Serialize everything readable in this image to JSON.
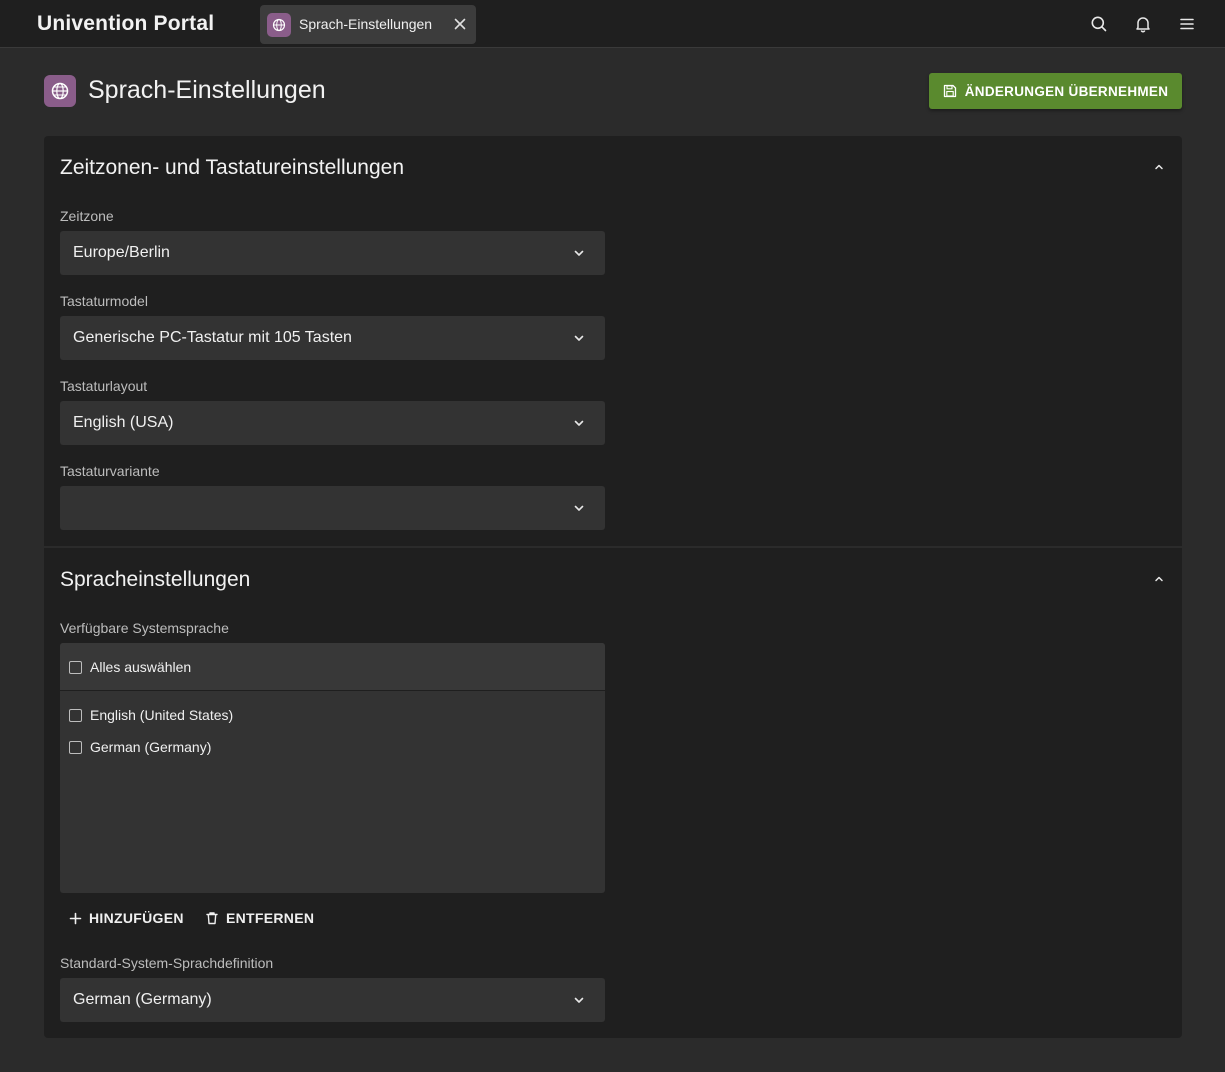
{
  "header": {
    "portal_title": "Univention Portal",
    "tab_label": "Sprach-Einstellungen"
  },
  "page": {
    "title": "Sprach-Einstellungen",
    "save_label": "ÄNDERUNGEN ÜBERNEHMEN",
    "accent_color": "#5a8a2e",
    "module_icon_color": "#8a5d8a"
  },
  "section_time": {
    "title": "Zeitzonen- und Tastatureinstellungen",
    "timezone_label": "Zeitzone",
    "timezone_value": "Europe/Berlin",
    "kbmodel_label": "Tastaturmodel",
    "kbmodel_value": "Generische PC-Tastatur mit 105 Tasten",
    "kblayout_label": "Tastaturlayout",
    "kblayout_value": "English (USA)",
    "kbvariant_label": "Tastaturvariante",
    "kbvariant_value": ""
  },
  "section_lang": {
    "title": "Spracheinstellungen",
    "available_label": "Verfügbare Systemsprache",
    "select_all_label": "Alles auswählen",
    "languages": [
      "English (United States)",
      "German (Germany)"
    ],
    "add_label": "HINZUFÜGEN",
    "remove_label": "ENTFERNEN",
    "default_label": "Standard-System-Sprachdefinition",
    "default_value": "German (Germany)"
  }
}
